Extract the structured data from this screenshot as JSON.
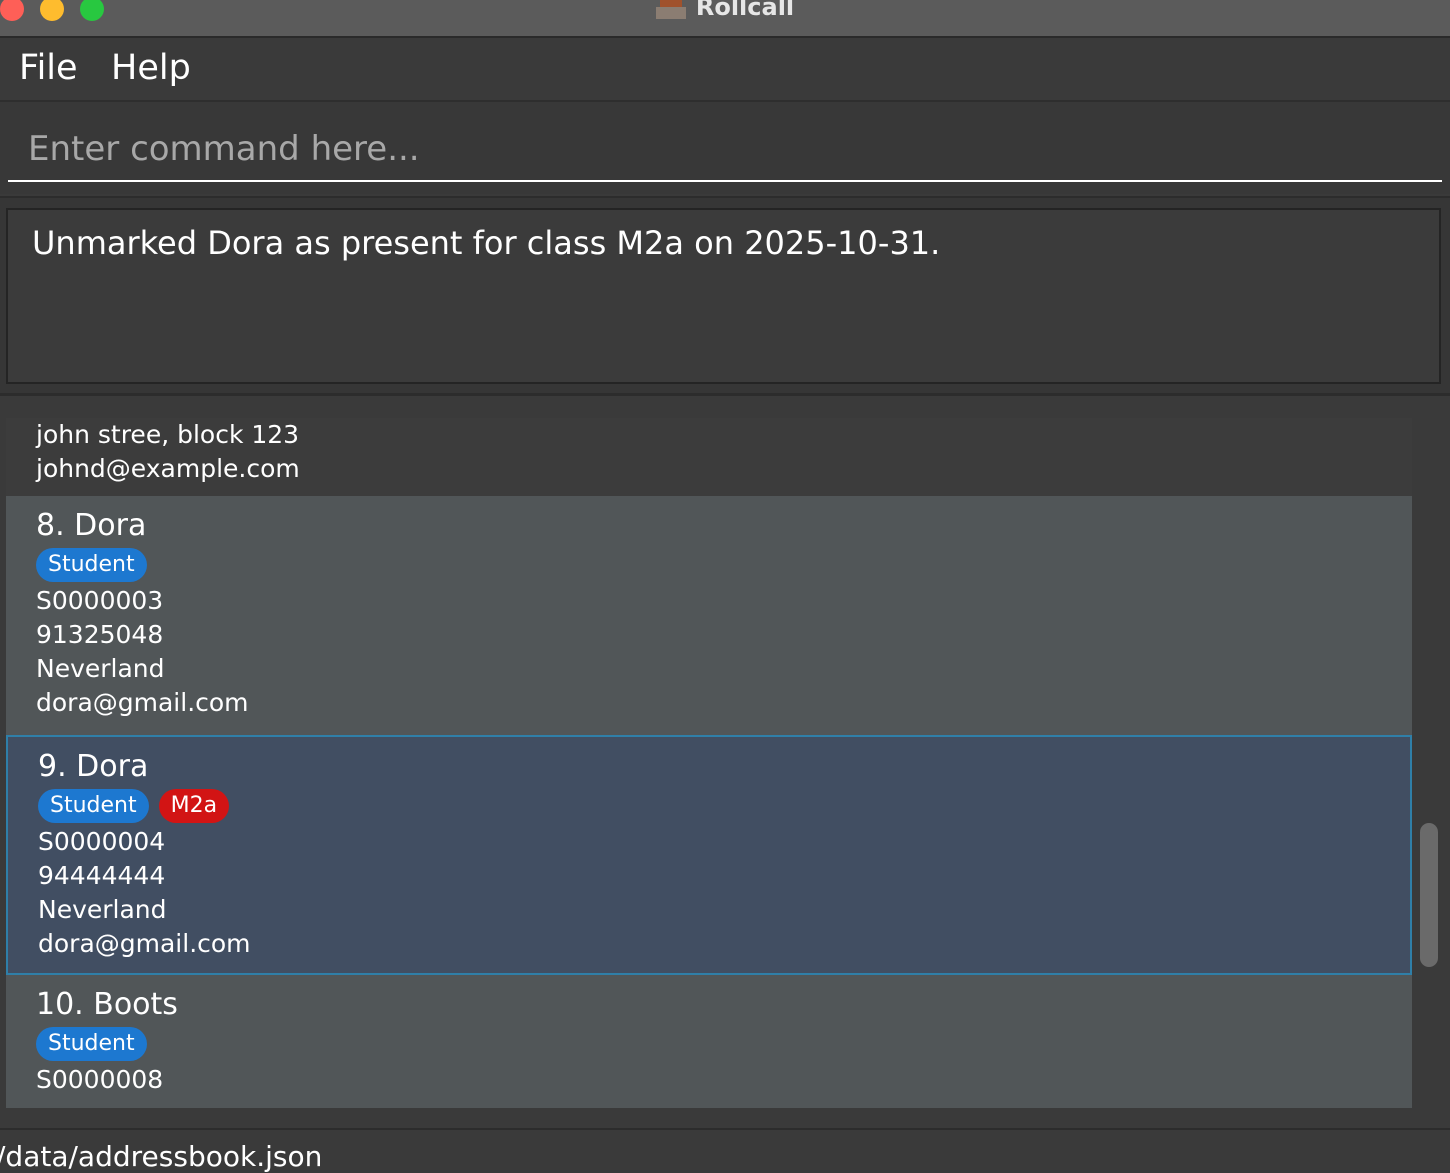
{
  "window": {
    "title": "Rollcall",
    "app_icon": "school-building-icon"
  },
  "menu": {
    "file_label": "File",
    "help_label": "Help"
  },
  "command": {
    "placeholder": "Enter command here...",
    "value": ""
  },
  "result": {
    "message": "Unmarked Dora as present for class M2a on 2025-10-31."
  },
  "persons": {
    "partial": {
      "address": "john stree, block 123",
      "email": "johnd@example.com"
    },
    "p8": {
      "title": "8. Dora",
      "tags": [
        "Student"
      ],
      "id": "S0000003",
      "phone": "91325048",
      "address": "Neverland",
      "email": "dora@gmail.com"
    },
    "p9": {
      "title": "9. Dora",
      "tags": [
        "Student",
        "M2a"
      ],
      "id": "S0000004",
      "phone": "94444444",
      "address": "Neverland",
      "email": "dora@gmail.com",
      "selected": true
    },
    "p10": {
      "title": "10. Boots",
      "tags": [
        "Student"
      ],
      "id": "S0000008"
    }
  },
  "colors": {
    "student_tag": "#1d78d0",
    "class_tag": "#d21414",
    "selected_border": "#2f7fa8"
  },
  "status": {
    "path": "/data/addressbook.json"
  }
}
